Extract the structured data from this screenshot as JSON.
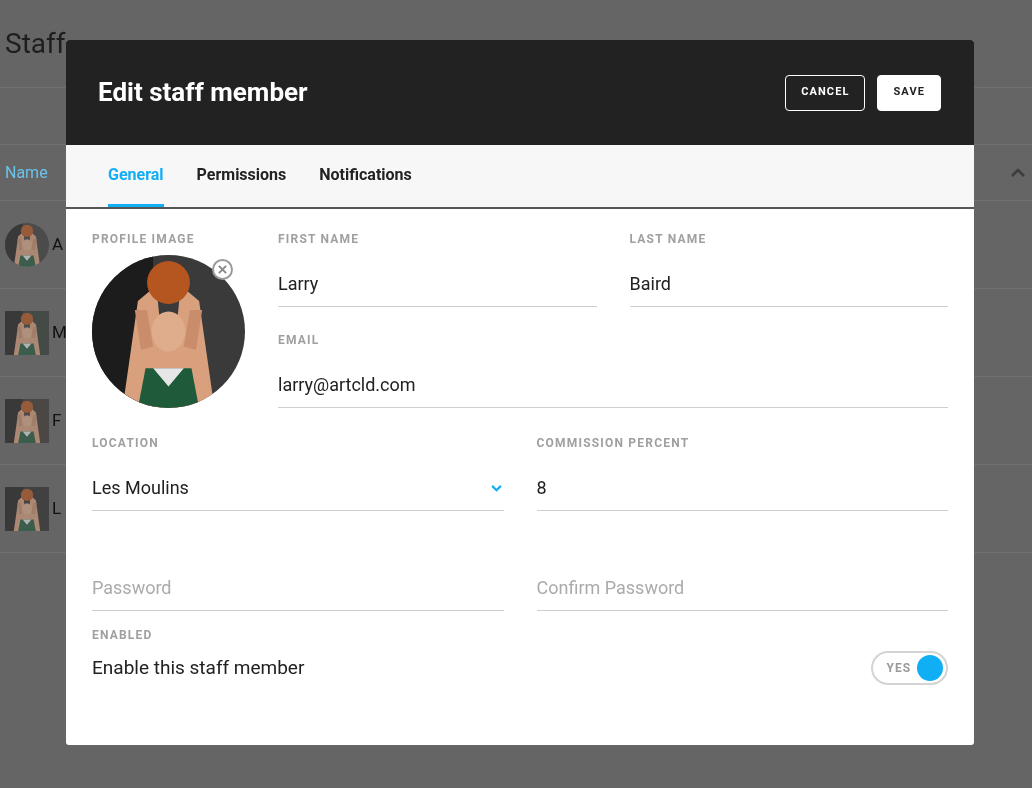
{
  "background": {
    "title": "Staff",
    "table": {
      "columns": [
        {
          "label": "Name"
        }
      ],
      "rows": [
        {
          "name": "A",
          "kind": "round"
        },
        {
          "name": "M",
          "kind": "square"
        },
        {
          "name": "F",
          "kind": "square"
        },
        {
          "name": "L",
          "kind": "square"
        }
      ]
    }
  },
  "dialog": {
    "title": "Edit staff member",
    "buttons": [
      {
        "label": "CANCEL",
        "kind": "outline"
      },
      {
        "label": "SAVE",
        "kind": "filled"
      }
    ],
    "tabs": [
      {
        "label": "General",
        "selected": true
      },
      {
        "label": "Permissions",
        "selected": false
      },
      {
        "label": "Notifications",
        "selected": false
      }
    ],
    "profile_image": {
      "label": "PROFILE IMAGE"
    },
    "first_name": {
      "label": "FIRST NAME",
      "value": "Larry"
    },
    "last_name": {
      "label": "LAST NAME",
      "value": "Baird"
    },
    "email": {
      "label": "EMAIL",
      "value": "larry@artcld.com"
    },
    "location": {
      "label": "LOCATION",
      "value": "Les Moulins"
    },
    "commission": {
      "label": "COMMISSION PERCENT",
      "value": "8"
    },
    "password": {
      "placeholder": "Password"
    },
    "confirm_password": {
      "placeholder": "Confirm Password"
    },
    "enabled": {
      "label": "ENABLED",
      "text": "Enable this staff member",
      "on": true,
      "on_label": "YES"
    }
  }
}
